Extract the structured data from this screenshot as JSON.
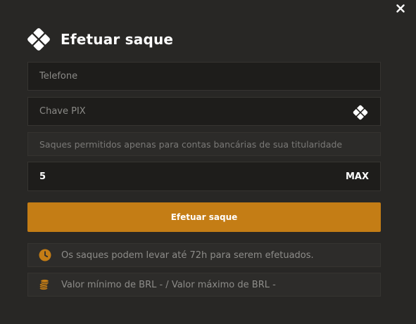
{
  "dialog": {
    "title": "Efetuar saque",
    "close_label": "✕",
    "logo_icon": "pix-logo-icon"
  },
  "form": {
    "phone_placeholder": "Telefone",
    "pix_key_placeholder": "Chave PIX",
    "notice": "Saques permitidos apenas para contas bancárias de sua titularidade",
    "amount_value": "5",
    "max_label": "MAX",
    "submit_label": "Efetuar saque"
  },
  "info": [
    {
      "icon": "clock-icon",
      "text": "Os saques podem levar até 72h para serem efetuados."
    },
    {
      "icon": "coins-icon",
      "text": "Valor mínimo de BRL - / Valor máximo de BRL -"
    }
  ],
  "colors": {
    "background": "#282725",
    "field_background": "#1e1d1b",
    "accent": "#c47d15",
    "text_primary": "#ffffff",
    "text_muted": "#8b8a87"
  }
}
